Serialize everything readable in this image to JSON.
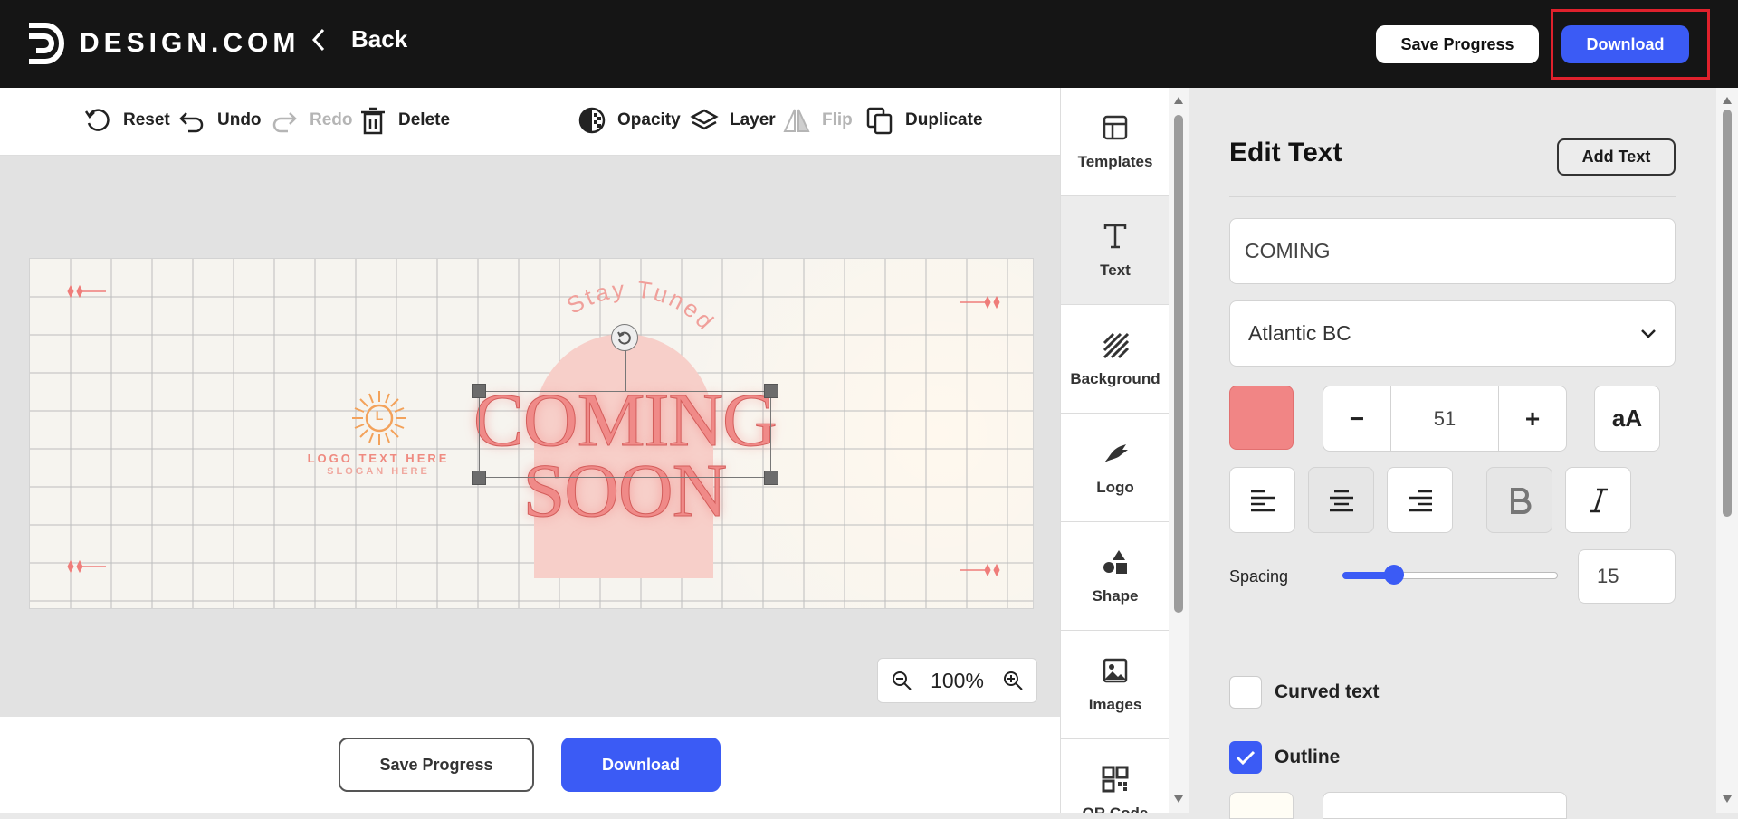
{
  "header": {
    "brand": "DESIGN.COM",
    "back_label": "Back",
    "save_label": "Save Progress",
    "download_label": "Download"
  },
  "toolbar": {
    "reset": "Reset",
    "undo": "Undo",
    "redo": "Redo",
    "delete": "Delete",
    "opacity": "Opacity",
    "layer": "Layer",
    "flip": "Flip",
    "duplicate": "Duplicate"
  },
  "canvas": {
    "curved_text": "Stay Tuned",
    "headline_line1": "COMING",
    "headline_line2": "SOON",
    "logo_letter": "L",
    "logo_text": "LOGO TEXT HERE",
    "slogan": "SLOGAN HERE",
    "accent_color": "#f08a88"
  },
  "zoom": {
    "value": "100%"
  },
  "footer": {
    "save_label": "Save Progress",
    "download_label": "Download"
  },
  "sidenav": {
    "items": [
      {
        "label": "Templates",
        "icon": "templates-icon"
      },
      {
        "label": "Text",
        "icon": "text-icon"
      },
      {
        "label": "Background",
        "icon": "background-icon"
      },
      {
        "label": "Logo",
        "icon": "logo-icon"
      },
      {
        "label": "Shape",
        "icon": "shape-icon"
      },
      {
        "label": "Images",
        "icon": "images-icon"
      },
      {
        "label": "QR Code",
        "icon": "qr-code-icon"
      }
    ],
    "active": "Text"
  },
  "panel": {
    "title": "Edit Text",
    "add_text_label": "Add Text",
    "text_value": "COMING",
    "font": "Atlantic BC",
    "color": "#f18585",
    "font_size": "51",
    "case_toggle": "aA",
    "spacing_label": "Spacing",
    "spacing_value": "15",
    "spacing_fraction": 0.24,
    "curved_text_label": "Curved text",
    "curved_text_checked": false,
    "outline_label": "Outline",
    "outline_checked": true,
    "alignment": "center"
  }
}
